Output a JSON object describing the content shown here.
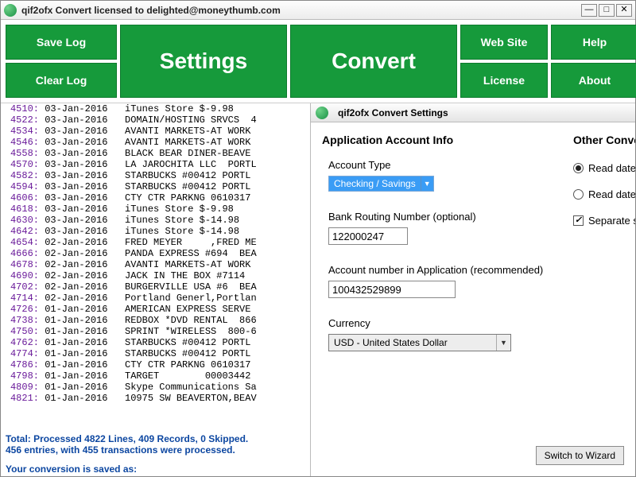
{
  "window": {
    "title": "qif2ofx Convert licensed to delighted@moneythumb.com"
  },
  "toolbar": {
    "save_log": "Save Log",
    "clear_log": "Clear Log",
    "settings": "Settings",
    "convert": "Convert",
    "web_site": "Web Site",
    "help": "Help",
    "license": "License",
    "about": "About"
  },
  "log": {
    "lines": [
      {
        "n": "4510:",
        "d": "03-Jan-2016",
        "t": "iTunes Store $-9.98"
      },
      {
        "n": "4522:",
        "d": "03-Jan-2016",
        "t": "DOMAIN/HOSTING SRVCS  4"
      },
      {
        "n": "4534:",
        "d": "03-Jan-2016",
        "t": "AVANTI MARKETS-AT WORK"
      },
      {
        "n": "4546:",
        "d": "03-Jan-2016",
        "t": "AVANTI MARKETS-AT WORK"
      },
      {
        "n": "4558:",
        "d": "03-Jan-2016",
        "t": "BLACK BEAR DINER-BEAVE"
      },
      {
        "n": "4570:",
        "d": "03-Jan-2016",
        "t": "LA JAROCHITA LLC  PORTL"
      },
      {
        "n": "4582:",
        "d": "03-Jan-2016",
        "t": "STARBUCKS #00412 PORTL"
      },
      {
        "n": "4594:",
        "d": "03-Jan-2016",
        "t": "STARBUCKS #00412 PORTL"
      },
      {
        "n": "4606:",
        "d": "03-Jan-2016",
        "t": "CTY CTR PARKNG 0610317"
      },
      {
        "n": "4618:",
        "d": "03-Jan-2016",
        "t": "iTunes Store $-9.98"
      },
      {
        "n": "4630:",
        "d": "03-Jan-2016",
        "t": "iTunes Store $-14.98"
      },
      {
        "n": "4642:",
        "d": "03-Jan-2016",
        "t": "iTunes Store $-14.98"
      },
      {
        "n": "4654:",
        "d": "02-Jan-2016",
        "t": "FRED MEYER     ,FRED ME"
      },
      {
        "n": "4666:",
        "d": "02-Jan-2016",
        "t": "PANDA EXPRESS #694  BEA"
      },
      {
        "n": "4678:",
        "d": "02-Jan-2016",
        "t": "AVANTI MARKETS-AT WORK"
      },
      {
        "n": "4690:",
        "d": "02-Jan-2016",
        "t": "JACK IN THE BOX #7114"
      },
      {
        "n": "4702:",
        "d": "02-Jan-2016",
        "t": "BURGERVILLE USA #6  BEA"
      },
      {
        "n": "4714:",
        "d": "02-Jan-2016",
        "t": "Portland Generl,Portlan"
      },
      {
        "n": "4726:",
        "d": "01-Jan-2016",
        "t": "AMERICAN EXPRESS SERVE"
      },
      {
        "n": "4738:",
        "d": "01-Jan-2016",
        "t": "REDBOX *DVD RENTAL  866"
      },
      {
        "n": "4750:",
        "d": "01-Jan-2016",
        "t": "SPRINT *WIRELESS  800-6"
      },
      {
        "n": "4762:",
        "d": "01-Jan-2016",
        "t": "STARBUCKS #00412 PORTL"
      },
      {
        "n": "4774:",
        "d": "01-Jan-2016",
        "t": "STARBUCKS #00412 PORTL"
      },
      {
        "n": "4786:",
        "d": "01-Jan-2016",
        "t": "CTY CTR PARKNG 0610317"
      },
      {
        "n": "4798:",
        "d": "01-Jan-2016",
        "t": "TARGET        00003442"
      },
      {
        "n": "4809:",
        "d": "01-Jan-2016",
        "t": "Skype Communications Sa"
      },
      {
        "n": "4821:",
        "d": "01-Jan-2016",
        "t": "10975 SW BEAVERTON,BEAV"
      }
    ],
    "footer1": "Total: Processed 4822 Lines, 409 Records, 0 Skipped.",
    "footer2": "456 entries, with 455 transactions were processed.",
    "footer3": "Your conversion is saved as:"
  },
  "settings": {
    "panel_title": "qif2ofx Convert Settings",
    "section_h": "Application Account Info",
    "other_h": "Other Conve",
    "account_type_label": "Account Type",
    "account_type_value": "Checking / Savings",
    "routing_label": "Bank Routing Number (optional)",
    "routing_value": "122000247",
    "acctnum_label": "Account number in Application (recommended)",
    "acctnum_value": "100432529899",
    "currency_label": "Currency",
    "currency_value": "USD - United States Dollar",
    "radio1": "Read dates",
    "radio2": "Read dates",
    "check1": "Separate s",
    "switch_btn": "Switch to Wizard"
  }
}
